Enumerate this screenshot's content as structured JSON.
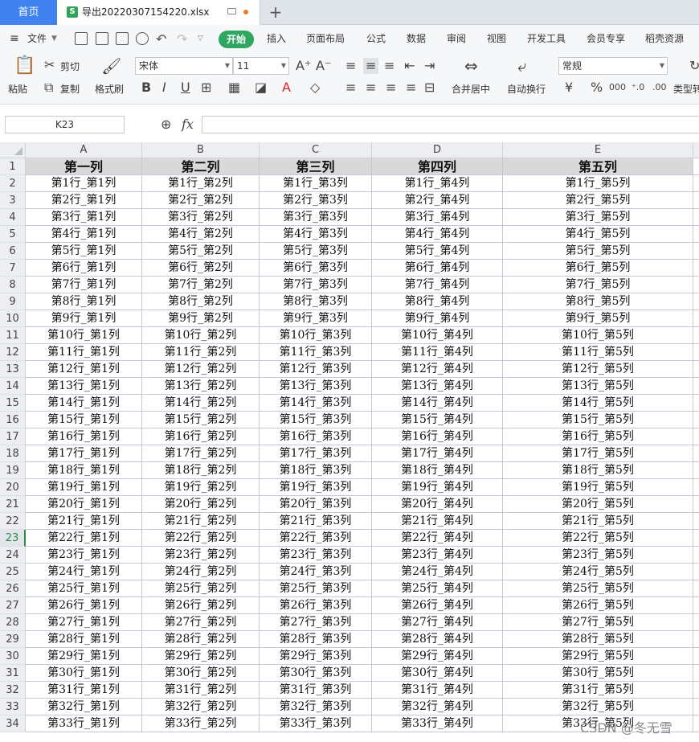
{
  "tabs": {
    "home": "首页",
    "file": "导出20220307154220.xlsx",
    "new_tab": "+"
  },
  "menubar": {
    "file_menu": "文件",
    "items": [
      "开始",
      "插入",
      "页面布局",
      "公式",
      "数据",
      "审阅",
      "视图",
      "开发工具",
      "会员专享",
      "稻壳资源"
    ]
  },
  "ribbon": {
    "paste": "粘贴",
    "cut": "剪切",
    "copy": "复制",
    "format_painter": "格式刷",
    "font_name": "宋体",
    "font_size": "11",
    "merge_center": "合并居中",
    "auto_wrap": "自动换行",
    "number_format": "常规",
    "type_convert": "类型转",
    "currency_symbol": "¥",
    "percent_symbol": "%"
  },
  "formula_bar": {
    "name_box": "K23",
    "fx": "fx",
    "content": ""
  },
  "grid": {
    "columns": [
      "A",
      "B",
      "C",
      "D",
      "E"
    ],
    "rows": [
      "1",
      "2",
      "3",
      "4",
      "5",
      "6",
      "7",
      "8",
      "9",
      "10",
      "11",
      "12",
      "13",
      "14",
      "15",
      "16",
      "17",
      "18",
      "19",
      "20",
      "21",
      "22",
      "23",
      "24",
      "25",
      "26",
      "27",
      "28",
      "29",
      "30",
      "31",
      "32",
      "33",
      "34"
    ],
    "active_row": "23",
    "header_row": [
      "第一列",
      "第二列",
      "第三列",
      "第四列",
      "第五列"
    ],
    "data_rows": [
      [
        "第1行_第1列",
        "第1行_第2列",
        "第1行_第3列",
        "第1行_第4列",
        "第1行_第5列"
      ],
      [
        "第2行_第1列",
        "第2行_第2列",
        "第2行_第3列",
        "第2行_第4列",
        "第2行_第5列"
      ],
      [
        "第3行_第1列",
        "第3行_第2列",
        "第3行_第3列",
        "第3行_第4列",
        "第3行_第5列"
      ],
      [
        "第4行_第1列",
        "第4行_第2列",
        "第4行_第3列",
        "第4行_第4列",
        "第4行_第5列"
      ],
      [
        "第5行_第1列",
        "第5行_第2列",
        "第5行_第3列",
        "第5行_第4列",
        "第5行_第5列"
      ],
      [
        "第6行_第1列",
        "第6行_第2列",
        "第6行_第3列",
        "第6行_第4列",
        "第6行_第5列"
      ],
      [
        "第7行_第1列",
        "第7行_第2列",
        "第7行_第3列",
        "第7行_第4列",
        "第7行_第5列"
      ],
      [
        "第8行_第1列",
        "第8行_第2列",
        "第8行_第3列",
        "第8行_第4列",
        "第8行_第5列"
      ],
      [
        "第9行_第1列",
        "第9行_第2列",
        "第9行_第3列",
        "第9行_第4列",
        "第9行_第5列"
      ],
      [
        "第10行_第1列",
        "第10行_第2列",
        "第10行_第3列",
        "第10行_第4列",
        "第10行_第5列"
      ],
      [
        "第11行_第1列",
        "第11行_第2列",
        "第11行_第3列",
        "第11行_第4列",
        "第11行_第5列"
      ],
      [
        "第12行_第1列",
        "第12行_第2列",
        "第12行_第3列",
        "第12行_第4列",
        "第12行_第5列"
      ],
      [
        "第13行_第1列",
        "第13行_第2列",
        "第13行_第3列",
        "第13行_第4列",
        "第13行_第5列"
      ],
      [
        "第14行_第1列",
        "第14行_第2列",
        "第14行_第3列",
        "第14行_第4列",
        "第14行_第5列"
      ],
      [
        "第15行_第1列",
        "第15行_第2列",
        "第15行_第3列",
        "第15行_第4列",
        "第15行_第5列"
      ],
      [
        "第16行_第1列",
        "第16行_第2列",
        "第16行_第3列",
        "第16行_第4列",
        "第16行_第5列"
      ],
      [
        "第17行_第1列",
        "第17行_第2列",
        "第17行_第3列",
        "第17行_第4列",
        "第17行_第5列"
      ],
      [
        "第18行_第1列",
        "第18行_第2列",
        "第18行_第3列",
        "第18行_第4列",
        "第18行_第5列"
      ],
      [
        "第19行_第1列",
        "第19行_第2列",
        "第19行_第3列",
        "第19行_第4列",
        "第19行_第5列"
      ],
      [
        "第20行_第1列",
        "第20行_第2列",
        "第20行_第3列",
        "第20行_第4列",
        "第20行_第5列"
      ],
      [
        "第21行_第1列",
        "第21行_第2列",
        "第21行_第3列",
        "第21行_第4列",
        "第21行_第5列"
      ],
      [
        "第22行_第1列",
        "第22行_第2列",
        "第22行_第3列",
        "第22行_第4列",
        "第22行_第5列"
      ],
      [
        "第23行_第1列",
        "第23行_第2列",
        "第23行_第3列",
        "第23行_第4列",
        "第23行_第5列"
      ],
      [
        "第24行_第1列",
        "第24行_第2列",
        "第24行_第3列",
        "第24行_第4列",
        "第24行_第5列"
      ],
      [
        "第25行_第1列",
        "第25行_第2列",
        "第25行_第3列",
        "第25行_第4列",
        "第25行_第5列"
      ],
      [
        "第26行_第1列",
        "第26行_第2列",
        "第26行_第3列",
        "第26行_第4列",
        "第26行_第5列"
      ],
      [
        "第27行_第1列",
        "第27行_第2列",
        "第27行_第3列",
        "第27行_第4列",
        "第27行_第5列"
      ],
      [
        "第28行_第1列",
        "第28行_第2列",
        "第28行_第3列",
        "第28行_第4列",
        "第28行_第5列"
      ],
      [
        "第29行_第1列",
        "第29行_第2列",
        "第29行_第3列",
        "第29行_第4列",
        "第29行_第5列"
      ],
      [
        "第30行_第1列",
        "第30行_第2列",
        "第30行_第3列",
        "第30行_第4列",
        "第30行_第5列"
      ],
      [
        "第31行_第1列",
        "第31行_第2列",
        "第31行_第3列",
        "第31行_第4列",
        "第31行_第5列"
      ],
      [
        "第32行_第1列",
        "第32行_第2列",
        "第32行_第3列",
        "第32行_第4列",
        "第32行_第5列"
      ],
      [
        "第33行_第1列",
        "第33行_第2列",
        "第33行_第3列",
        "第33行_第4列",
        "第33行_第5列"
      ]
    ]
  },
  "watermark": "CSDN @冬无雪",
  "colors": {
    "home_tab": "#3f82f0",
    "start_button": "#2fa760",
    "active_row": "#2b8c4f",
    "header_fill": "#d9d9d9"
  }
}
